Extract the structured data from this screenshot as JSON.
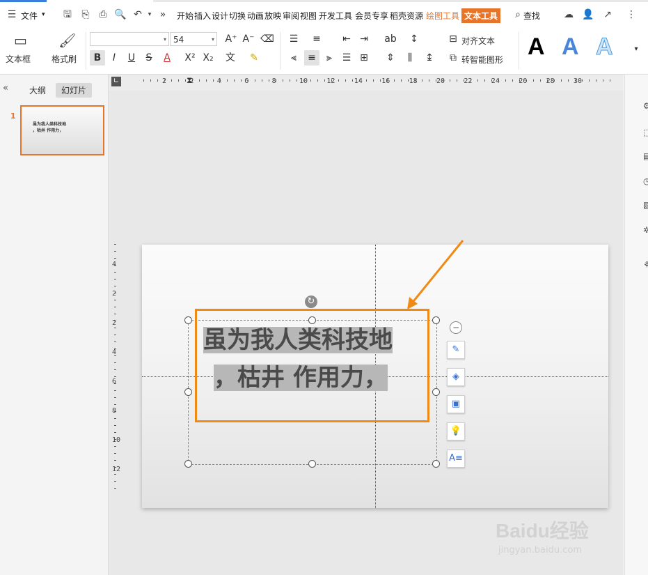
{
  "menubar": {
    "file_label": "文件",
    "tabs": [
      "开始",
      "插入",
      "设计",
      "切换",
      "动画",
      "放映",
      "审阅",
      "视图",
      "开发工具",
      "会员专享",
      "稻壳资源",
      "绘图工具",
      "文本工具"
    ],
    "search_label": "查找"
  },
  "ribbon": {
    "textbox_label": "文本框",
    "format_painter_label": "格式刷",
    "font_name": "",
    "font_size": "54",
    "align_text_label": "对齐文本",
    "smart_shape_label": "转智能图形"
  },
  "left_panel": {
    "tab_outline": "大纲",
    "tab_slides": "幻灯片",
    "slide_number": "1",
    "thumb_line1": "虽为我人类科技地",
    "thumb_line2": "，枯井 作用力，"
  },
  "ruler": {
    "h_labels": [
      "2",
      "2",
      "4",
      "6",
      "8",
      "10",
      "12",
      "14",
      "16",
      "18",
      "20",
      "22",
      "24",
      "26",
      "28",
      "30"
    ],
    "v_labels": [
      "4",
      "2",
      "2",
      "4",
      "6",
      "8",
      "10",
      "12"
    ]
  },
  "slide": {
    "text_line1": "虽为我人类科技地",
    "text_line2": "，枯井 作用力，"
  },
  "watermark": {
    "brand": "Baidu经验",
    "url": "jingyan.baidu.com"
  },
  "colors": {
    "accent_orange": "#e8742a",
    "highlight_border": "#f08a14",
    "arrow": "#f08a14",
    "text_gray": "#4a4a4a"
  }
}
